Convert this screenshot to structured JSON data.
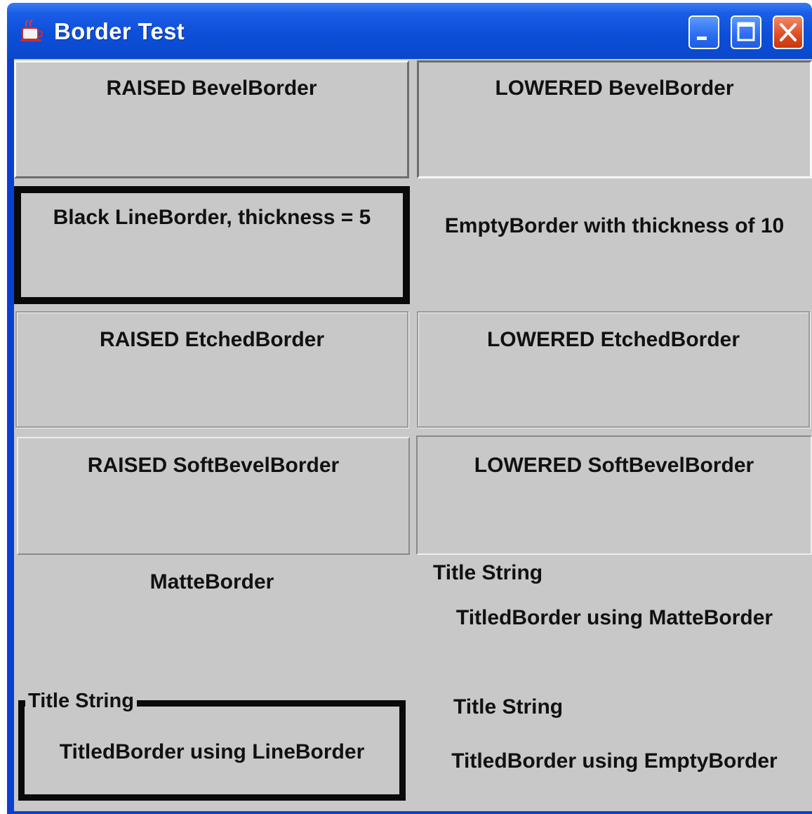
{
  "window": {
    "title": "Border Test",
    "app_icon": "java-cup-icon",
    "controls": [
      "minimize-icon",
      "maximize-icon",
      "close-icon"
    ]
  },
  "panels": {
    "raised_bevel": "RAISED BevelBorder",
    "lowered_bevel": "LOWERED BevelBorder",
    "line_border": "Black LineBorder, thickness = 5",
    "empty_border": "EmptyBorder with thickness of 10",
    "raised_etched": "RAISED EtchedBorder",
    "lowered_etched": "LOWERED EtchedBorder",
    "raised_soft_bevel": "RAISED SoftBevelBorder",
    "lowered_soft_bevel": "LOWERED SoftBevelBorder",
    "matte_border": "MatteBorder",
    "titled_matte": {
      "title": "Title String",
      "label": "TitledBorder using MatteBorder"
    },
    "titled_line": {
      "title": "Title String",
      "label": "TitledBorder using LineBorder"
    },
    "titled_empty": {
      "title": "Title String",
      "label": "TitledBorder using EmptyBorder"
    }
  },
  "colors": {
    "titlebar": "#0d4fd8",
    "panel_background": "#c8c8c8",
    "line_border": "#0a0a0a",
    "close_button": "#de4b22"
  }
}
